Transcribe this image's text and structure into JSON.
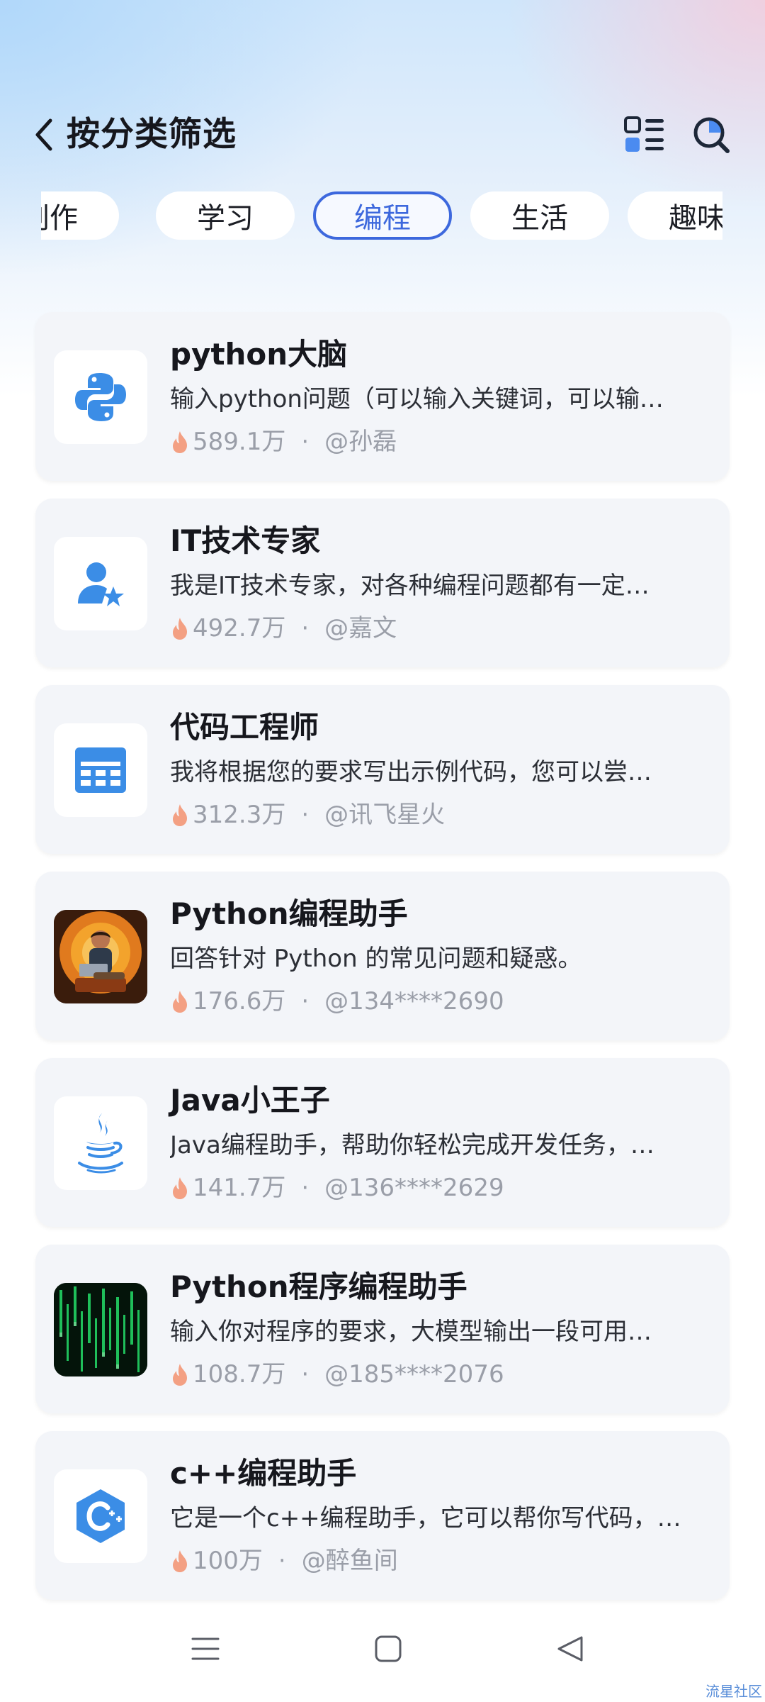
{
  "header": {
    "title": "按分类筛选",
    "back_icon": "chevron-left-icon",
    "layout_icon": "list-layout-icon",
    "search_icon": "search-icon"
  },
  "tabs": [
    {
      "label": "创作",
      "active": false
    },
    {
      "label": "学习",
      "active": false
    },
    {
      "label": "编程",
      "active": true
    },
    {
      "label": "生活",
      "active": false
    },
    {
      "label": "趣味",
      "active": false
    }
  ],
  "cards": [
    {
      "title": "python大脑",
      "desc": "输入python问题（可以输入关键词，可以输…",
      "heat": "589.1万",
      "author": "@孙磊",
      "icon": "python-logo-icon"
    },
    {
      "title": "IT技术专家",
      "desc": "我是IT技术专家，对各种编程问题都有一定…",
      "heat": "492.7万",
      "author": "@嘉文",
      "icon": "user-star-icon"
    },
    {
      "title": "代码工程师",
      "desc": "我将根据您的要求写出示例代码，您可以尝…",
      "heat": "312.3万",
      "author": "@讯飞星火",
      "icon": "code-window-icon"
    },
    {
      "title": "Python编程助手",
      "desc": "回答针对 Python 的常见问题和疑惑。",
      "heat": "176.6万",
      "author": "@134****2690",
      "icon": "programmer-avatar-icon"
    },
    {
      "title": "Java小王子",
      "desc": "Java编程助手，帮助你轻松完成开发任务，…",
      "heat": "141.7万",
      "author": "@136****2629",
      "icon": "java-logo-icon"
    },
    {
      "title": "Python程序编程助手",
      "desc": "输入你对程序的要求，大模型输出一段可用…",
      "heat": "108.7万",
      "author": "@185****2076",
      "icon": "matrix-code-icon"
    },
    {
      "title": "c++编程助手",
      "desc": "它是一个c++编程助手，它可以帮你写代码，…",
      "heat": "100万",
      "author": "@醉鱼间",
      "icon": "cpp-logo-icon"
    }
  ],
  "meta_separator": "·",
  "navbar": {
    "menu_icon": "menu-icon",
    "home_icon": "home-square-icon",
    "back_icon": "back-triangle-icon"
  },
  "watermark": "流星社区",
  "colors": {
    "accent": "#3d68dd",
    "fire": "#f3a083",
    "card_bg": "#f3f5f9"
  }
}
